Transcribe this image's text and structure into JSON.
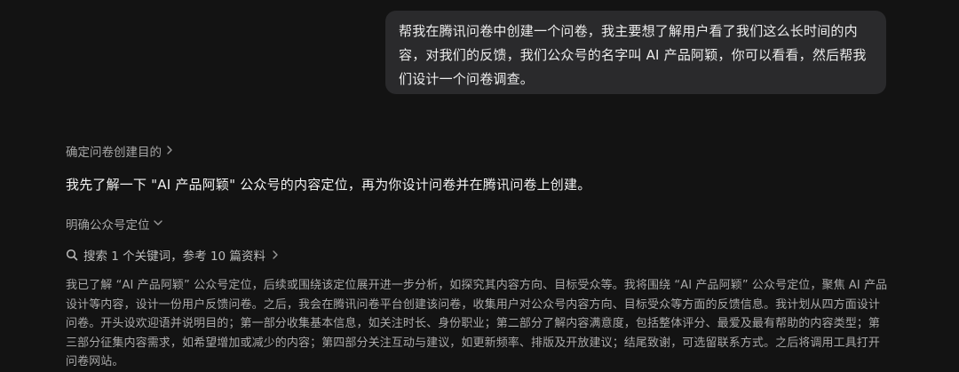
{
  "user_message": {
    "text": "帮我在腾讯问卷中创建一个问卷，我主要想了解用户看了我们这么长时间的内容，对我们的反馈，我们公众号的名字叫 AI 产品阿颖，你可以看看，然后帮我们设计一个问卷调查。"
  },
  "assistant": {
    "purpose_link_label": "确定问卷创建目的",
    "reply_text": "我先了解一下 \"AI 产品阿颖\" 公众号的内容定位，再为你设计问卷并在腾讯问卷上创建。",
    "step_label": "明确公众号定位",
    "search_summary": "搜索 1 个关键词，参考 10 篇资料",
    "thinking_text": "我已了解 “AI 产品阿颖” 公众号定位，后续或围绕该定位展开进一步分析，如探究其内容方向、目标受众等。我将围绕 “AI 产品阿颖” 公众号定位，聚焦 AI 产品设计等内容，设计一份用户反馈问卷。之后，我会在腾讯问卷平台创建该问卷，收集用户对公众号内容方向、目标受众等方面的反馈信息。我计划从四方面设计问卷。开头设欢迎语并说明目的；第一部分收集基本信息，如关注时长、身份职业；第二部分了解内容满意度，包括整体评分、最爱及最有帮助的内容类型；第三部分征集内容需求，如希望增加或减少的内容；第四部分关注互动与建议，如更新频率、排版及开放建议；结尾致谢，可选留联系方式。之后将调用工具打开问卷网站。"
  },
  "icons": {
    "chevron_right": "chevron-right-icon",
    "chevron_down": "chevron-down-icon",
    "search": "search-icon"
  },
  "colors": {
    "background": "#131313",
    "user_bubble": "#2a2a2c",
    "primary_text": "#f2f2f2",
    "secondary_text": "#a9a9a9"
  }
}
